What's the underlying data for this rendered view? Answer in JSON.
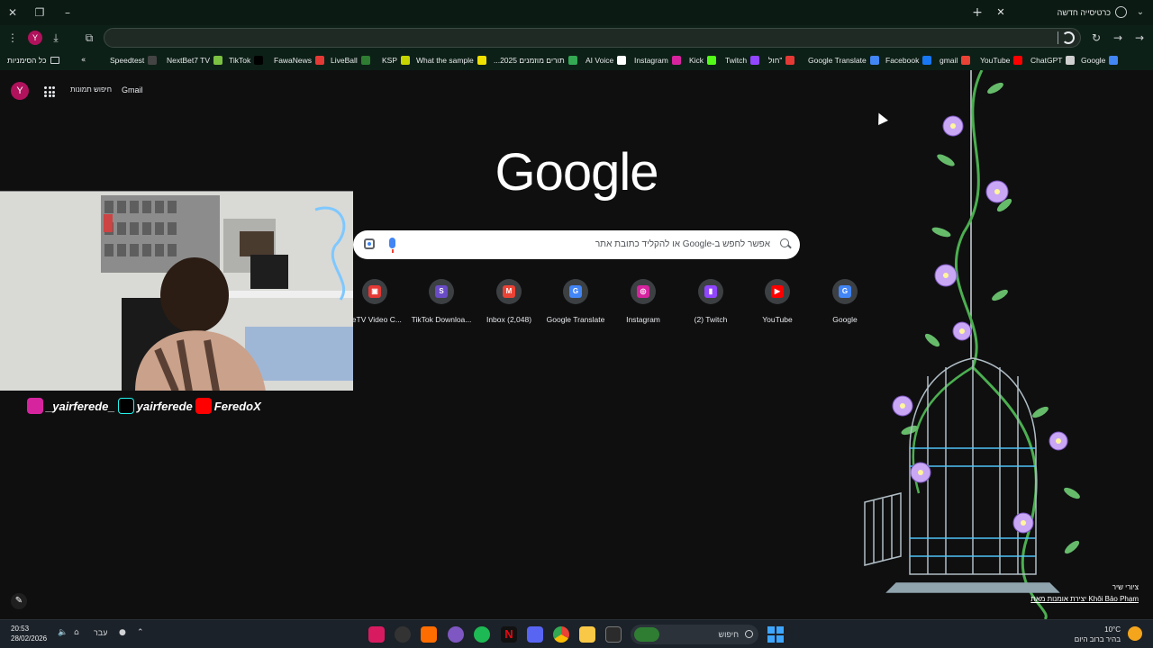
{
  "window": {
    "tab_title": "כרטיסייה חדשה",
    "close_label": "✕",
    "new_tab_label": "+"
  },
  "toolbar": {
    "profile_initial": "Y",
    "omnibox_value": ""
  },
  "bookmarks": {
    "all_label": "כל הסימניות",
    "items": [
      {
        "label": "Speedtest",
        "color": "#444444"
      },
      {
        "label": "NextBet7 TV",
        "color": "#7cc242"
      },
      {
        "label": "TikTok",
        "color": "#000000"
      },
      {
        "label": "FawaNews",
        "color": "#e53935"
      },
      {
        "label": "LiveBall",
        "color": "#2e7d32"
      },
      {
        "label": "KSP",
        "color": "#c6d500"
      },
      {
        "label": "What the sample",
        "color": "#f0e000"
      },
      {
        "label": "...2025 תורים מוזמנים",
        "color": "#34a853"
      },
      {
        "label": "AI Voice",
        "color": "#ffffff"
      },
      {
        "label": "Instagram",
        "color": "#d6249f"
      },
      {
        "label": "Kick",
        "color": "#53fc18"
      },
      {
        "label": "Twitch",
        "color": "#9146ff"
      },
      {
        "label": "חול\"",
        "color": "#e53935"
      },
      {
        "label": "Google Translate",
        "color": "#4285f4"
      },
      {
        "label": "Facebook",
        "color": "#1877f2"
      },
      {
        "label": "gmail",
        "color": "#ea4335"
      },
      {
        "label": "YouTube",
        "color": "#ff0000"
      },
      {
        "label": "ChatGPT",
        "color": "#cfcfcf"
      },
      {
        "label": "Google",
        "color": "#4285f4"
      }
    ]
  },
  "header": {
    "gmail": "Gmail",
    "images": "חיפוש תמונות",
    "avatar_initial": "Y"
  },
  "logo": "Google",
  "search": {
    "placeholder": "אפשר לחפש ב-Google או להקליד כתובת אתר"
  },
  "shortcuts": [
    {
      "label": "neTV Video C...",
      "color": "#e53935",
      "glyph": "▣"
    },
    {
      "label": "TikTok Downloa...",
      "color": "#6a4cc6",
      "glyph": "S"
    },
    {
      "label": "Inbox (2,048)",
      "color": "#ea4335",
      "glyph": "M"
    },
    {
      "label": "Google Translate",
      "color": "#4285f4",
      "glyph": "G"
    },
    {
      "label": "Instagram",
      "color": "#d6249f",
      "glyph": "◎"
    },
    {
      "label": "(2) Twitch",
      "color": "#9146ff",
      "glyph": "▮"
    },
    {
      "label": "YouTube",
      "color": "#ff0000",
      "glyph": "▶"
    },
    {
      "label": "Google",
      "color": "#4285f4",
      "glyph": "G"
    }
  ],
  "overlay": {
    "instagram": "_yairferede_",
    "tiktok": "yairferede",
    "youtube": "FeredoX"
  },
  "wallpaper_credit": {
    "line1": "ציורי שיר",
    "line2": "Khôi Bảo Phạm יצירת אומנות מאת"
  },
  "taskbar": {
    "time": "20:53",
    "date": "28/02/2026",
    "lang": "עבר",
    "search_label": "חיפוש",
    "weather_temp": "10°C",
    "weather_desc": "בהיר ברוב היום"
  }
}
